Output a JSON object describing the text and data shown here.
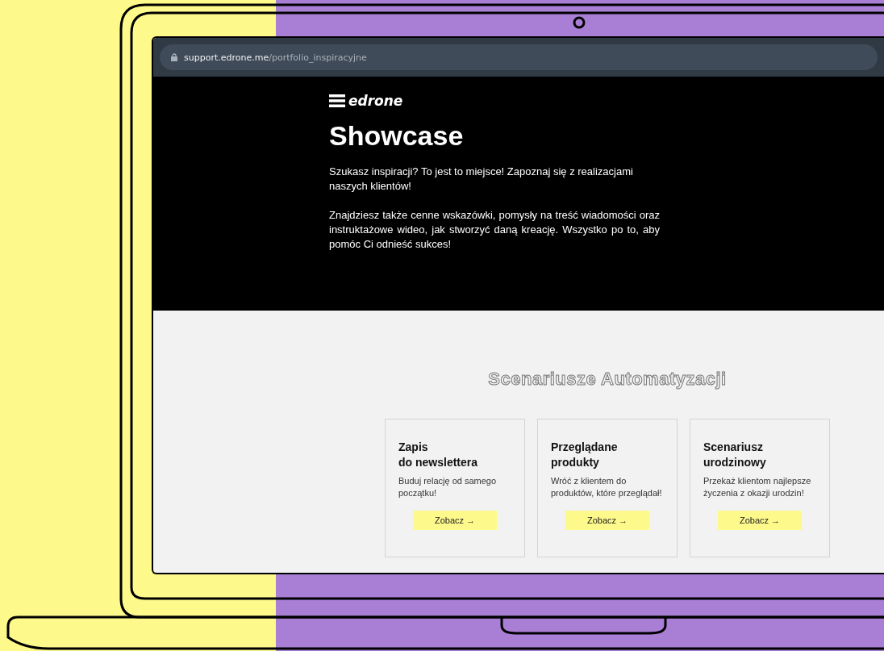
{
  "address_bar": {
    "host": "support.edrone.me",
    "path": "/portfolio_inspiracyjne"
  },
  "hero": {
    "logo": "edrone",
    "title": "Showcase",
    "paragraphs": [
      "Szukasz inspiracji? To jest to miejsce! Zapoznaj się z realizacjami naszych klientów!",
      "Znajdziesz także cenne wskazówki, pomysły na treść wiadomości oraz instruktażowe wideo, jak stworzyć daną kreację. Wszystko po to, aby pomóc Ci odnieść sukces!"
    ]
  },
  "section": {
    "title": "Scenariusze Automatyzacji",
    "cards": [
      {
        "title_lines": [
          "Zapis",
          "do newslettera"
        ],
        "text": "Buduj relację od samego początku!",
        "button": "Zobacz →"
      },
      {
        "title_lines": [
          "Przeglądane",
          "produkty"
        ],
        "text": "Wróć z klientem do produktów, które przeglądał!",
        "button": "Zobacz →"
      },
      {
        "title_lines": [
          "Scenariusz",
          "urodzinowy"
        ],
        "text": "Przekaż klientom najlepsze życzenia z okazji urodzin!",
        "button": "Zobacz →"
      }
    ]
  }
}
